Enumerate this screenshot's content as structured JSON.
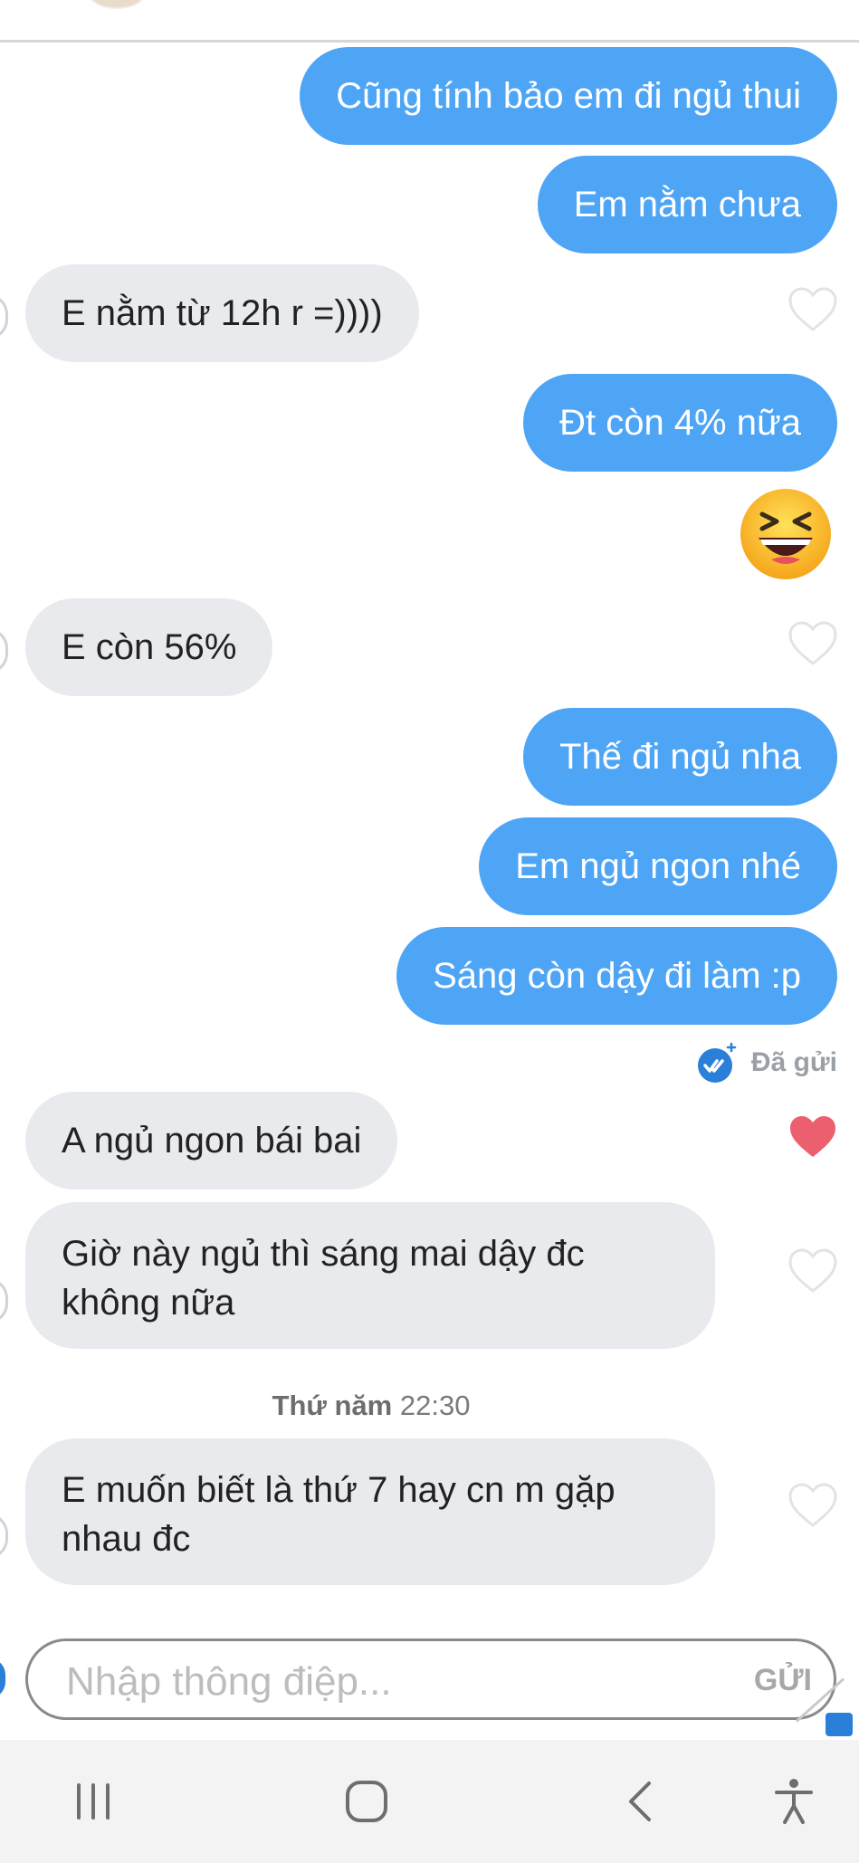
{
  "messages": [
    {
      "side": "out",
      "text": "Cũng tính bảo em đi ngủ thui"
    },
    {
      "side": "out",
      "text": "Em nằm chưa"
    },
    {
      "side": "in",
      "text": "E nằm từ 12h r =))))"
    },
    {
      "side": "out",
      "text": "Đt còn 4% nữa"
    },
    {
      "side": "out",
      "emoji": "laughing-squinting-face"
    },
    {
      "side": "in",
      "text": "E còn 56%"
    },
    {
      "side": "out",
      "text": "Thế đi ngủ nha"
    },
    {
      "side": "out",
      "text": "Em ngủ ngon nhé"
    },
    {
      "side": "out",
      "text": "Sáng còn dậy đi làm :p"
    },
    {
      "side": "in",
      "text": "A ngủ ngon bái bai",
      "liked": true
    },
    {
      "side": "in",
      "text": "Giờ này ngủ thì sáng mai dậy đc không nữa"
    },
    {
      "side": "in",
      "text": "E muốn biết là thứ 7 hay cn m gặp nhau đc"
    }
  ],
  "status": {
    "sent_label": "Đã gửi",
    "icon": "double-check-badge-icon"
  },
  "divider": {
    "day": "Thứ năm",
    "time": "22:30"
  },
  "composer": {
    "placeholder": "Nhập thông điệp...",
    "send_label": "GỬI"
  },
  "colors": {
    "outgoing": "#4ea5f5",
    "incoming": "#e9eaee",
    "heart_liked": "#ec5f6f",
    "accent": "#2a7fd8"
  },
  "navbar": {
    "icons": [
      "recent-apps-icon",
      "home-icon",
      "back-icon",
      "accessibility-icon"
    ]
  }
}
